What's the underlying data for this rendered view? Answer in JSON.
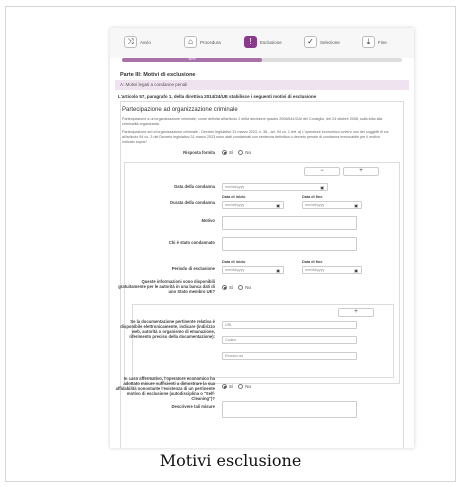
{
  "steps": [
    {
      "label": "Avvio",
      "icon": "shuffle-icon"
    },
    {
      "label": "Procedura",
      "icon": "building-icon"
    },
    {
      "label": "Esclusione",
      "icon": "exclamation-icon"
    },
    {
      "label": "Selezione",
      "icon": "check-circle-icon"
    },
    {
      "label": "Fine",
      "icon": "download-icon"
    }
  ],
  "progress": {
    "percent": "50%",
    "fraction": 0.5
  },
  "part_title": "Parte III: Motivi di esclusione",
  "section_bar": "A: Motivi legati a condanne penali",
  "article_line": "L'articolo 57, paragrafo 1, della direttiva 2014/24/UE stabilisce i seguenti motivi di esclusione",
  "panel_title": "Partecipazione ad organizzazione criminale",
  "desc1": "Partecipazione a un'organizzazione criminale, come definita all'articolo 2 della decisione quadro 2008/841/GAI del Consiglio, del 24 ottobre 2008, sulla lotta alla criminalità organizzata.",
  "desc2": "Partecipazione ad un'organizzazione criminale - Decreto legislativo 31 marzo 2023, n. 36 - art. 94 co. 1 lett. a) L'operatore economico ovvero uno dei soggetti di cui all'articolo 94 co. 3 del Decreto legislativo 31 marzo 2023 sono stati condannati con sentenza definitiva o decreto penale di condanna irrevocabile per il motivo indicato sopra?",
  "risposta": {
    "label": "Risposta fornita",
    "yes": "Sì",
    "no": "No",
    "selected": "yes"
  },
  "buttons": {
    "remove": "−",
    "add": "+",
    "add2": "+"
  },
  "fields": {
    "data_condanna": "Data della condanna",
    "durata_condanna": "Durata della condanna",
    "motivo": "Motivo",
    "chi_condannato": "Chi è stato condannato",
    "periodo_esclusione": "Periodo di esclusione",
    "info_disponibili": "Queste informazioni sono disponibili gratuitamente per le autorità in una banca dati di uno Stato membro UE?",
    "documentazione": "Se la documentazione pertinente relativa è disponibile elettronicamente, indicare (indirizzo web, autorità o organismo di emanazione, riferimento preciso della documentazione):",
    "self_cleaning": "In caso affermativo, l'operatore economico ha adottato misure sufficienti a dimostrare la sua affidabilità nonostante l'esistenza di un pertinente motivo di esclusione (autodisciplina o \"Self-Cleaning\")?",
    "descrivere": "Descrivere tali misure"
  },
  "caps": {
    "data_inizio": "Data di inizio",
    "data_fine": "Data di fine"
  },
  "placeholders": {
    "date": "mm/dd/yyyy",
    "url": "URL",
    "codice": "Codice",
    "emesso": "Emesso da"
  },
  "caption": "Motivi esclusione"
}
